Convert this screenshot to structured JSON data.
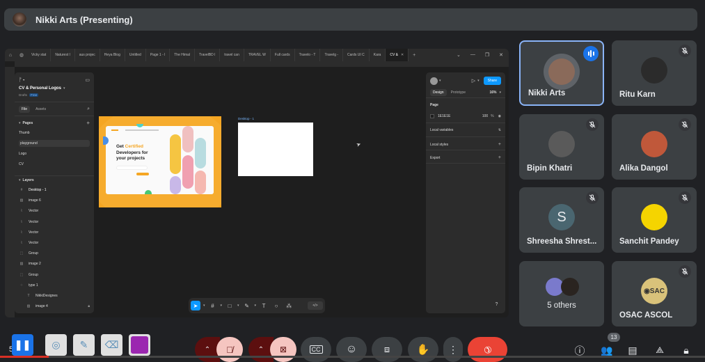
{
  "presenter": {
    "name": "Nikki Arts (Presenting)"
  },
  "screen": {
    "browser_tabs": [
      "Vicky stat",
      "Naturest l",
      "aus projec",
      "Heya Blog",
      "Untitled",
      "Page 1 - l",
      "The Himal",
      "TravelBD l",
      "travel can",
      "TRAVEL W",
      "Full cards",
      "Travelo - T",
      "Travelg -",
      "Cards UI C",
      "Kara",
      "CV &"
    ],
    "active_tab_index": 15,
    "new_tab": "+",
    "left_panel": {
      "file_title": "CV & Personal Logos",
      "location": "Drafts",
      "plan_badge": "Free",
      "tabs": [
        "File",
        "Assets"
      ],
      "pages_header": "Pages",
      "pages": [
        "Thumb",
        "playground",
        "Logo",
        "CV"
      ],
      "active_page_index": 1,
      "layers_header": "Layers",
      "layers": [
        {
          "name": "Desktop - 1",
          "type": "frame"
        },
        {
          "name": "image 6",
          "type": "image"
        },
        {
          "name": "Vector",
          "type": "vector"
        },
        {
          "name": "Vector",
          "type": "vector"
        },
        {
          "name": "Vector",
          "type": "vector"
        },
        {
          "name": "Vector",
          "type": "vector"
        },
        {
          "name": "Group",
          "type": "group"
        },
        {
          "name": "image 2",
          "type": "image"
        },
        {
          "name": "Group",
          "type": "group"
        },
        {
          "name": "type 1",
          "type": "component"
        },
        {
          "name": "NikkiDesignes",
          "type": "text"
        },
        {
          "name": "image 4",
          "type": "image",
          "locked": true
        }
      ]
    },
    "canvas": {
      "hero": {
        "word1": "Get ",
        "accent": "Certified",
        "line2": "Developers for",
        "line3": "your projects"
      },
      "frame2_label": "Desktop - 1"
    },
    "right_panel": {
      "share_label": "Share",
      "tabs": [
        "Design",
        "Prototype"
      ],
      "zoom": "16%",
      "page_label": "Page",
      "bg_color": "1E1E1E",
      "bg_opacity": "100",
      "percent": "%",
      "sections": [
        "Local variables",
        "Local styles",
        "Export"
      ]
    },
    "help": "?"
  },
  "participants": [
    {
      "name": "Nikki Arts",
      "speaking": true,
      "muted": false,
      "avatar_color": "#8a6a5a"
    },
    {
      "name": "Ritu Karn",
      "speaking": false,
      "muted": true,
      "avatar_color": "#2b2b2b"
    },
    {
      "name": "Bipin Khatri",
      "speaking": false,
      "muted": true,
      "avatar_color": "#5a5a5a"
    },
    {
      "name": "Alika Dangol",
      "speaking": false,
      "muted": true,
      "avatar_color": "#c0583a"
    },
    {
      "name": "Shreesha Shrest...",
      "speaking": false,
      "muted": true,
      "initial": "S",
      "avatar_color": "#4a6670"
    },
    {
      "name": "Sanchit Pandey",
      "speaking": false,
      "muted": true,
      "avatar_color": "#f5d400"
    },
    {
      "name": "5 others",
      "speaking": false,
      "muted": false
    },
    {
      "name": "OSAC ASCOL",
      "speaking": false,
      "muted": true,
      "logo_text": "SAC",
      "avatar_color": "#d9c27a"
    }
  ],
  "bottom": {
    "time_partial": "5   M",
    "participants_count": "13",
    "annotation_color": "#9b27b0",
    "accent_end_call": "#ea4335"
  }
}
